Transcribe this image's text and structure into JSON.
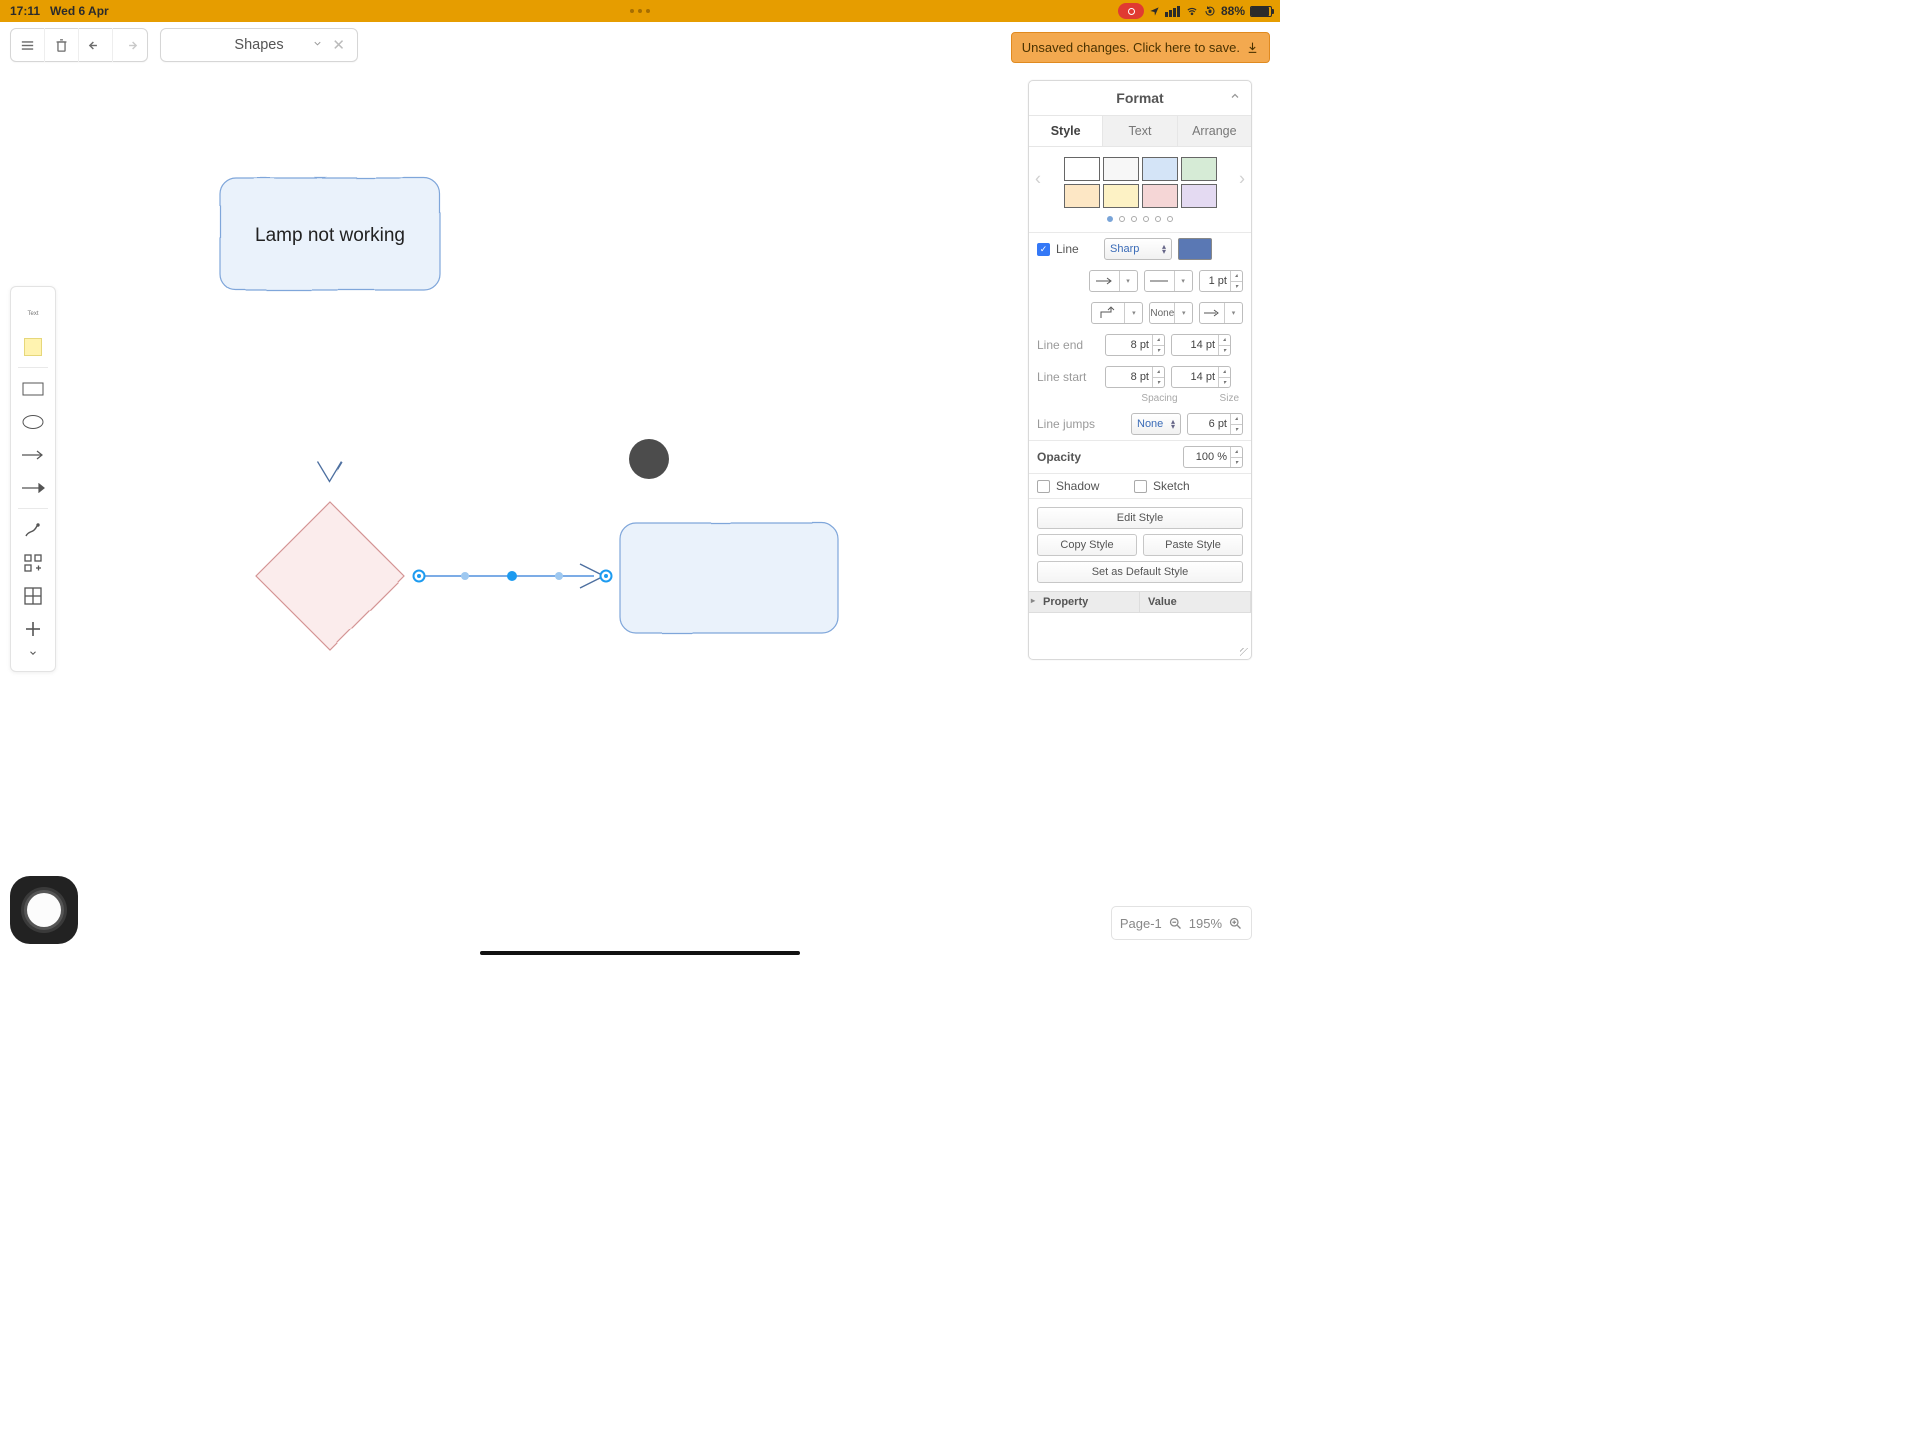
{
  "statusbar": {
    "time": "17:11",
    "date": "Wed 6 Apr",
    "battery_pct": "88%"
  },
  "topbar": {
    "shapes_label": "Shapes"
  },
  "save_banner": "Unsaved changes. Click here to save.",
  "palette": {
    "text_label": "Text"
  },
  "canvas": {
    "node_lamp": "Lamp not working"
  },
  "format": {
    "title": "Format",
    "tabs": {
      "style": "Style",
      "text": "Text",
      "arrange": "Arrange"
    },
    "swatch_colors": [
      "#ffffff",
      "#f7f7f7",
      "#d4e4f7",
      "#d6ebd6",
      "#fde7c5",
      "#fdf2c5",
      "#f5d6d6",
      "#e4daf2"
    ],
    "line": {
      "label": "Line",
      "style": "Sharp",
      "color": "#5a78b4",
      "width": "1 pt",
      "waypoint_none": "None",
      "end_label": "Line end",
      "start_label": "Line start",
      "end_spacing": "8 pt",
      "end_size": "14 pt",
      "start_spacing": "8 pt",
      "start_size": "14 pt",
      "sub_spacing": "Spacing",
      "sub_size": "Size",
      "jumps_label": "Line jumps",
      "jumps_style": "None",
      "jumps_size": "6 pt"
    },
    "opacity": {
      "label": "Opacity",
      "value": "100 %"
    },
    "shadow": "Shadow",
    "sketch": "Sketch",
    "btn_edit": "Edit Style",
    "btn_copy": "Copy Style",
    "btn_paste": "Paste Style",
    "btn_default": "Set as Default Style",
    "prop_header": "Property",
    "val_header": "Value"
  },
  "footer": {
    "page": "Page-1",
    "zoom": "195%"
  }
}
